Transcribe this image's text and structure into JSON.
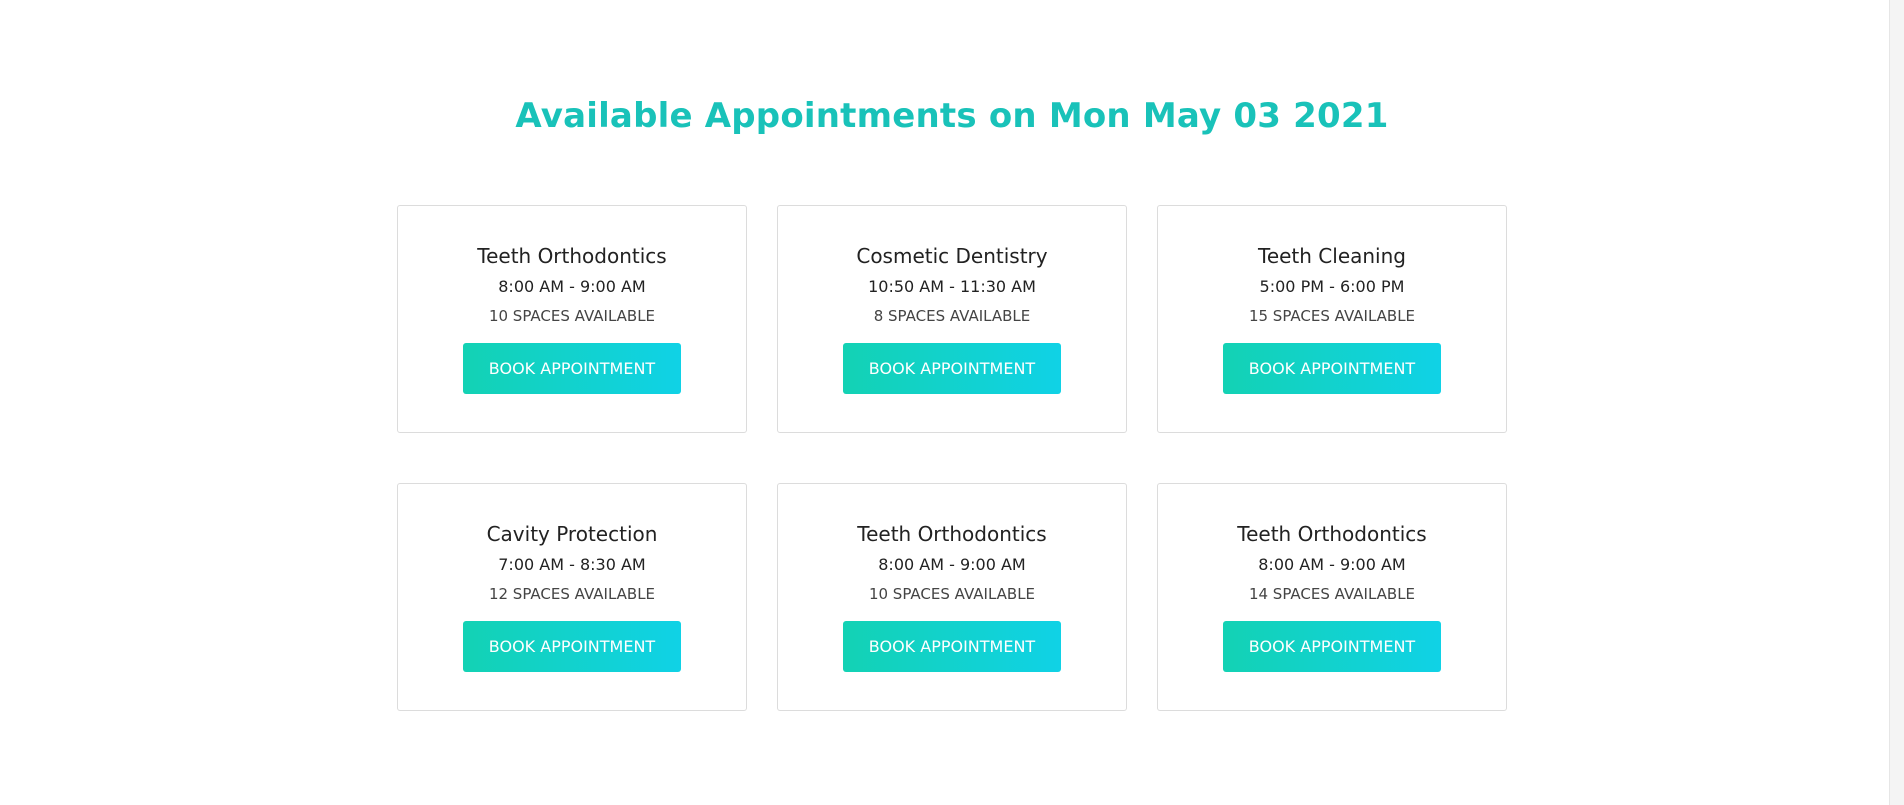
{
  "header": {
    "title": "Available Appointments on Mon May 03 2021"
  },
  "appointments": [
    {
      "service": "Teeth Orthodontics",
      "time": "8:00 AM - 9:00 AM",
      "spaces": "10 SPACES AVAILABLE",
      "button_label": "BOOK APPOINTMENT"
    },
    {
      "service": "Cosmetic Dentistry",
      "time": "10:50 AM - 11:30 AM",
      "spaces": "8 SPACES AVAILABLE",
      "button_label": "BOOK APPOINTMENT"
    },
    {
      "service": "Teeth Cleaning",
      "time": "5:00 PM - 6:00 PM",
      "spaces": "15 SPACES AVAILABLE",
      "button_label": "BOOK APPOINTMENT"
    },
    {
      "service": "Cavity Protection",
      "time": "7:00 AM - 8:30 AM",
      "spaces": "12 SPACES AVAILABLE",
      "button_label": "BOOK APPOINTMENT"
    },
    {
      "service": "Teeth Orthodontics",
      "time": "8:00 AM - 9:00 AM",
      "spaces": "10 SPACES AVAILABLE",
      "button_label": "BOOK APPOINTMENT"
    },
    {
      "service": "Teeth Orthodontics",
      "time": "8:00 AM - 9:00 AM",
      "spaces": "14 SPACES AVAILABLE",
      "button_label": "BOOK APPOINTMENT"
    }
  ],
  "colors": {
    "accent": "#19c2b9",
    "button_gradient_start": "#13d2b4",
    "button_gradient_end": "#10d2e6",
    "card_border": "#dcdcdc"
  }
}
